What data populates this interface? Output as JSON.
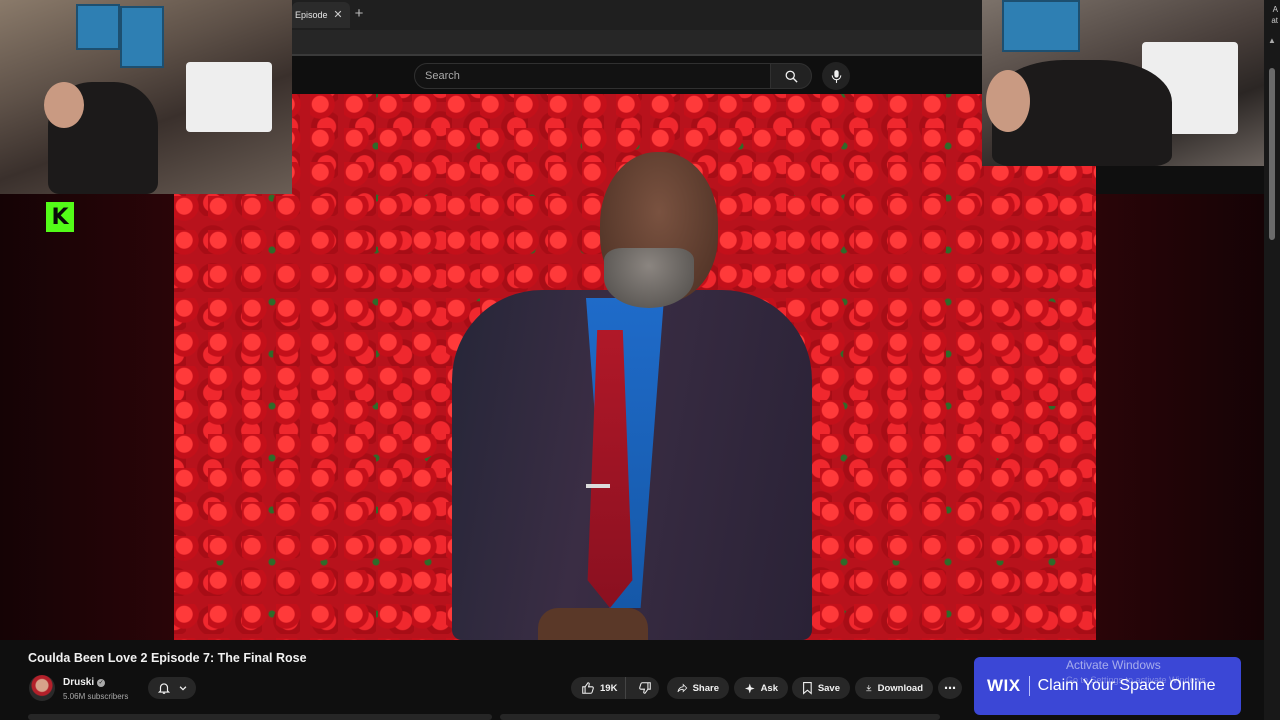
{
  "browser": {
    "tab_title": "Episode",
    "tab_close_icon": "close-icon",
    "new_tab_icon": "plus-icon"
  },
  "youtube": {
    "search": {
      "placeholder": "Search"
    },
    "video": {
      "title": "Coulda Been Love 2 Episode 7: The Final Rose",
      "channel": "Druski",
      "subscribers": "5.06M subscribers",
      "likes": "19K"
    },
    "actions": {
      "share": "Share",
      "ask": "Ask",
      "save": "Save",
      "download": "Download"
    }
  },
  "overlay": {
    "kick_logo": "K",
    "ad": {
      "brand": "WIX",
      "text": "Claim Your Space Online"
    },
    "watermark": {
      "title": "Activate Windows",
      "subtitle": "Go to Settings to activate Windows."
    },
    "scrollbar_text": [
      "A",
      "at"
    ]
  },
  "colors": {
    "background": "#0f0f0f",
    "pill": "#272727",
    "kick_green": "#53fc18",
    "wix_blue": "#3b47d6",
    "rose_red": "#b8121c"
  }
}
